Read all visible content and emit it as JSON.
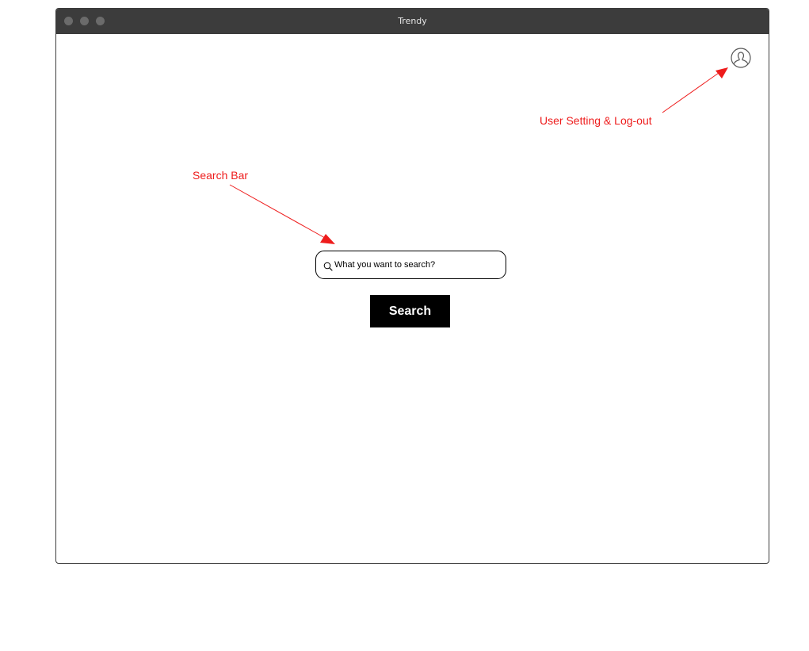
{
  "window": {
    "title": "Trendy"
  },
  "header": {
    "user_icon": "user-icon"
  },
  "search": {
    "icon": "search-icon",
    "placeholder": "What you want to search?",
    "value": "",
    "button_label": "Search"
  },
  "annotations": {
    "search_bar_label": "Search Bar",
    "user_setting_label": "User Setting & Log-out",
    "color": "#ee1c1c"
  }
}
